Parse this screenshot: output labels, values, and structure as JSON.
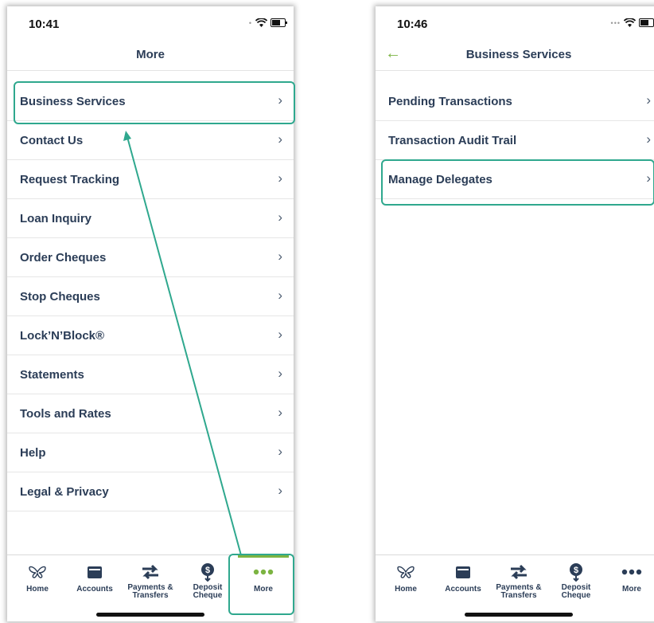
{
  "left_screen": {
    "status_time": "10:41",
    "title": "More",
    "menu_items": [
      {
        "label": "Business Services"
      },
      {
        "label": "Contact Us"
      },
      {
        "label": "Request Tracking"
      },
      {
        "label": "Loan Inquiry"
      },
      {
        "label": "Order Cheques"
      },
      {
        "label": "Stop Cheques"
      },
      {
        "label": "Lock’N’Block®"
      },
      {
        "label": "Statements"
      },
      {
        "label": "Tools and Rates"
      },
      {
        "label": "Help"
      },
      {
        "label": "Legal & Privacy"
      }
    ],
    "chevron": "›"
  },
  "right_screen": {
    "status_time": "10:46",
    "title": "Business Services",
    "back_icon": "←",
    "menu_items": [
      {
        "label": "Pending Transactions"
      },
      {
        "label": "Transaction Audit Trail"
      },
      {
        "label": "Manage Delegates"
      }
    ],
    "chevron": "›"
  },
  "tab_bar": {
    "tabs": [
      {
        "label": "Home",
        "icon": "butterfly-icon"
      },
      {
        "label": "Accounts",
        "icon": "wallet-icon"
      },
      {
        "label": "Payments & Transfers",
        "icon": "transfer-arrows-icon"
      },
      {
        "label": "Deposit Cheque",
        "icon": "deposit-icon"
      },
      {
        "label": "More",
        "icon": "more-dots-icon"
      }
    ],
    "active_tab": "More"
  },
  "colors": {
    "text": "#2b3d57",
    "accent_green": "#7cb442",
    "highlight_teal": "#2fa88e"
  }
}
